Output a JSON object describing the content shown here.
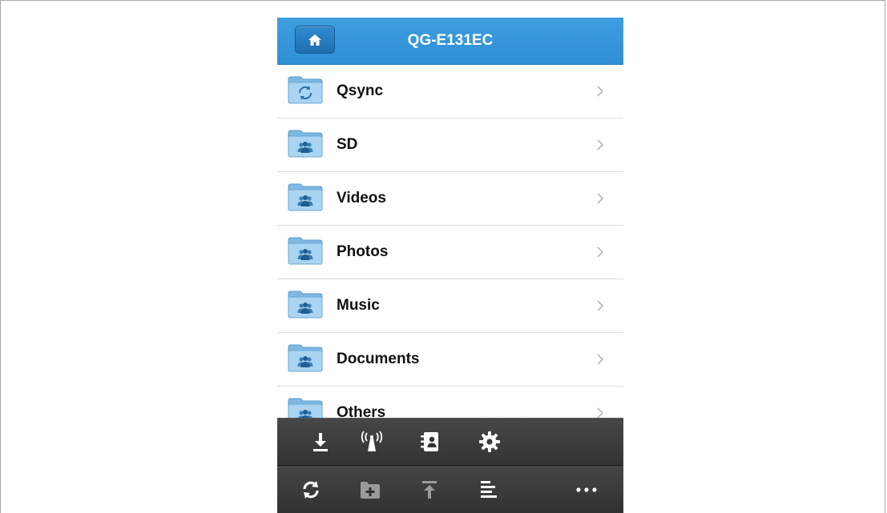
{
  "header": {
    "title": "QG-E131EC",
    "home_icon": "home-icon"
  },
  "folders": [
    {
      "label": "Qsync",
      "icon": "sync-folder-icon"
    },
    {
      "label": "SD",
      "icon": "shared-folder-icon"
    },
    {
      "label": "Videos",
      "icon": "shared-folder-icon"
    },
    {
      "label": "Photos",
      "icon": "shared-folder-icon"
    },
    {
      "label": "Music",
      "icon": "shared-folder-icon"
    },
    {
      "label": "Documents",
      "icon": "shared-folder-icon"
    },
    {
      "label": "Others",
      "icon": "shared-folder-icon"
    }
  ],
  "toolbar": {
    "top_row": [
      "download-icon",
      "wireless-icon",
      "contacts-icon",
      "settings-icon"
    ],
    "bottom_row": [
      "refresh-icon",
      "new-folder-icon",
      "upload-icon",
      "sort-icon",
      "more-icon"
    ]
  },
  "colors": {
    "header": "#3597db",
    "toolbar": "#363636",
    "folder": "#8ec3e8",
    "text": "#111111"
  }
}
